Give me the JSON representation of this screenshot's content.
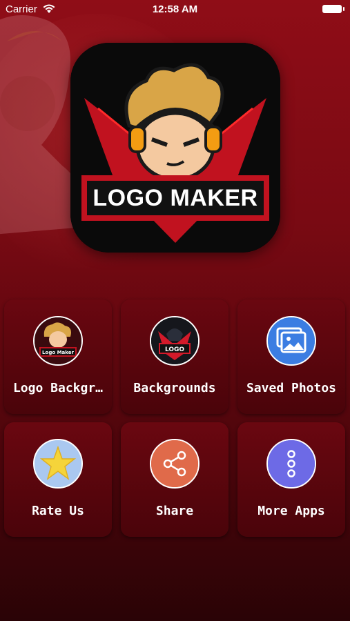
{
  "status_bar": {
    "carrier": "Carrier",
    "time": "12:58 AM"
  },
  "app_logo": {
    "text": "LOGO MAKER"
  },
  "menu": {
    "items": [
      {
        "label": "Logo Backgr…",
        "icon": "logo-maker-thumbnail-icon"
      },
      {
        "label": "Backgrounds",
        "icon": "gaming-logo-thumbnail-icon"
      },
      {
        "label": "Saved Photos",
        "icon": "photos-icon"
      },
      {
        "label": "Rate Us",
        "icon": "star-icon"
      },
      {
        "label": "Share",
        "icon": "share-icon"
      },
      {
        "label": "More Apps",
        "icon": "more-dots-icon"
      }
    ]
  },
  "colors": {
    "background": "#7a0a13",
    "tile": "#5a050d",
    "share_orange": "#e06a4a",
    "more_purple": "#6d6ae6",
    "photos_blue": "#3b7de2",
    "star_yellow": "#f5d43a"
  }
}
